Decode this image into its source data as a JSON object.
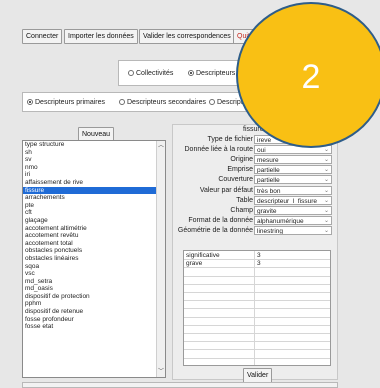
{
  "toolbar": {
    "connect": "Connecter",
    "import": "Importer les données",
    "validate_map": "Valider les correspondences",
    "quit": "Quitt"
  },
  "mode_radios": {
    "collectivites": "Collectivités",
    "descripteurs": "Descripteurs",
    "selected": "Descripteurs"
  },
  "type_radios": {
    "primaires": "Descripteurs primaires",
    "secondaires": "Descripteurs secondaires",
    "third": "Descripte",
    "selected": "Descripteurs primaires"
  },
  "list_panel": {
    "new_button": "Nouveau",
    "items": [
      "type structure",
      "sh",
      "sv",
      "nmo",
      "iri",
      "affaissement de rive",
      "fissure",
      "arrachements",
      "pte",
      "cft",
      "glaçage",
      "accotement altimétrie",
      "accotement revêtu",
      "accotement total",
      "obstacles ponctuels",
      "obstacles linéaires",
      "sqoa",
      "vsc",
      "md_setra",
      "md_oasis",
      "dispositif de protection",
      "pphm",
      "dispositif de retenue",
      "fosse profondeur",
      "fosse etat"
    ],
    "selected_item": "fissure"
  },
  "form": {
    "title": "fissure",
    "fields": [
      {
        "label": "Type de fichier",
        "value": "ireve",
        "dropdown": false
      },
      {
        "label": "Donnée liée à la route",
        "value": "oui",
        "dropdown": true
      },
      {
        "label": "Origine",
        "value": "mesure",
        "dropdown": true
      },
      {
        "label": "Emprise",
        "value": "partielle",
        "dropdown": true
      },
      {
        "label": "Couverture",
        "value": "partielle",
        "dropdown": true
      },
      {
        "label": "Valeur par défaut",
        "value": "très bon",
        "dropdown": true
      },
      {
        "label": "Table",
        "value": "descripteur_l_fissure",
        "dropdown": true
      },
      {
        "label": "Champ",
        "value": "gravite",
        "dropdown": true
      },
      {
        "label": "Format de la donnée",
        "value": "alphanumérique",
        "dropdown": true
      },
      {
        "label": "Géométrie de la donnée",
        "value": "linestring",
        "dropdown": true
      }
    ],
    "grid_rows": [
      {
        "name": "significative",
        "value": "3"
      },
      {
        "name": "grave",
        "value": "3"
      }
    ],
    "validate_button": "Valider"
  },
  "overlay": {
    "step_number": "2",
    "fill_color": "#f9c014",
    "border_color": "#2e5d89"
  }
}
